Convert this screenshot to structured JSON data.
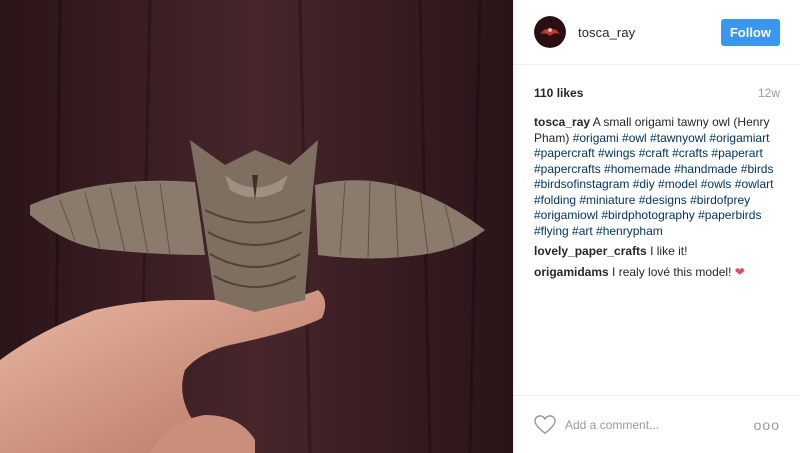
{
  "post": {
    "username": "tosca_ray",
    "follow_label": "Follow",
    "likes": "110 likes",
    "age": "12w",
    "caption_user": "tosca_ray",
    "caption_text": "A small origami tawny owl (Henry Pham)",
    "hashtags": "#origami #owl #tawnyowl #origamiart #papercraft #wings #craft #crafts #paperart #papercrafts #homemade #handmade #birds #birdsofinstagram #diy #model #owls #owlart #folding #miniature #designs #birdofprey #origamiowl #birdphotography #paperbirds #flying #art #henrypham"
  },
  "comments": [
    {
      "user": "lovely_paper_crafts",
      "text": "I like it!"
    },
    {
      "user": "origamidams",
      "text": "I realy lové this model!"
    }
  ],
  "comment_box": {
    "placeholder": "Add a comment..."
  },
  "more_label": "ooo",
  "colors": {
    "follow_bg": "#3897f0",
    "heart": "#ed4956",
    "hashtag": "#003569"
  }
}
